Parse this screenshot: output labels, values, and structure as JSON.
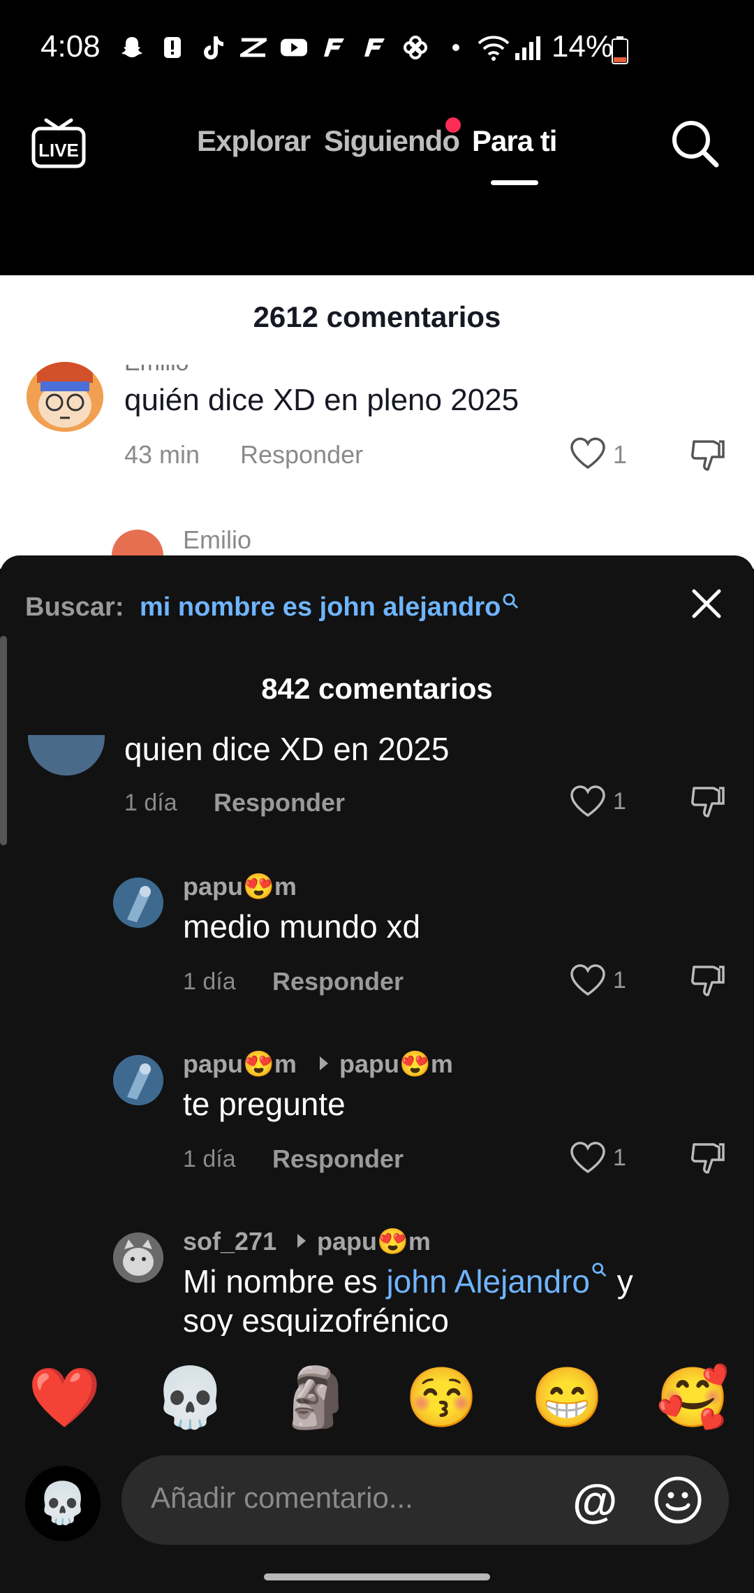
{
  "status_bar": {
    "time": "4:08",
    "battery": "14%",
    "icons": [
      "snapchat-icon",
      "alert-icon",
      "tiktok-icon",
      "capcut-icon",
      "youtube-icon",
      "fanatiz-icon",
      "fanatiz-icon",
      "pinwheel-icon",
      "dot-icon"
    ]
  },
  "nav": {
    "tabs": [
      {
        "label": "Explorar",
        "active": false
      },
      {
        "label": "Siguiendo",
        "active": false
      },
      {
        "label": "Para ti",
        "active": true
      }
    ],
    "live_label": "LIVE"
  },
  "background_panel": {
    "title": "2612 comentarios",
    "comment": {
      "author": "Emilio",
      "text": "quién dice XD en pleno 2025",
      "time": "43 min",
      "reply_label": "Responder",
      "likes": "1"
    },
    "reply_author": "Emilio"
  },
  "sheet": {
    "search_label": "Buscar:",
    "search_query": "mi nombre es john alejandro",
    "title": "842 comentarios",
    "comments": [
      {
        "author": "",
        "text": "quien dice XD en 2025",
        "time": "1 día",
        "reply_label": "Responder",
        "likes": "1"
      },
      {
        "author": "papu😍m",
        "reply_to": "",
        "text": "medio mundo xd",
        "time": "1 día",
        "reply_label": "Responder",
        "likes": "1"
      },
      {
        "author": "papu😍m",
        "reply_to": "papu😍m",
        "text": "te pregunte",
        "time": "1 día",
        "reply_label": "Responder",
        "likes": "1"
      },
      {
        "author": "sof_271",
        "reply_to": "papu😍m",
        "text_before": "Mi nombre es ",
        "text_link": "john Alejandro",
        "text_after": " y",
        "text_line2": "soy esquizofrénico"
      }
    ],
    "emojis": [
      "❤️",
      "💀",
      "🗿",
      "😚",
      "😁",
      "🥰"
    ],
    "compose_placeholder": "Añadir comentario...",
    "at_symbol": "@",
    "avatar_emoji": "💀"
  },
  "colors": {
    "accent_blue": "#6fb5ff",
    "notification_red": "#fe2c55",
    "sheet_bg": "#121212"
  }
}
